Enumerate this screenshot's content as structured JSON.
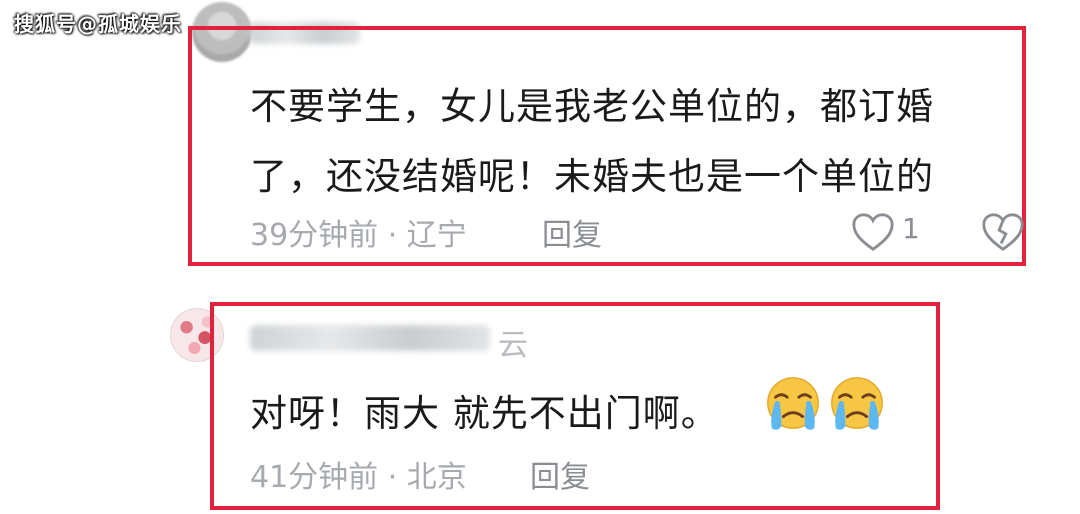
{
  "watermark": "搜狐号@孤城娱乐",
  "comments": [
    {
      "line1": "不要学生，女儿是我老公单位的，都订婚",
      "line2": "了，还没结婚呢！未婚夫也是一个单位的",
      "meta": "39分钟前 · 辽宁",
      "reply_label": "回复",
      "like_count": "1"
    },
    {
      "username_tail": "云",
      "line1": "对呀！雨大 就先不出门啊。",
      "meta": "41分钟前 · 北京",
      "reply_label": "回复",
      "emojis": [
        "crying-face-icon",
        "crying-face-icon"
      ]
    }
  ],
  "colors": {
    "highlight_border": "#e0233d",
    "meta_text": "#a6aaae",
    "body_text": "#1a1a1a"
  }
}
